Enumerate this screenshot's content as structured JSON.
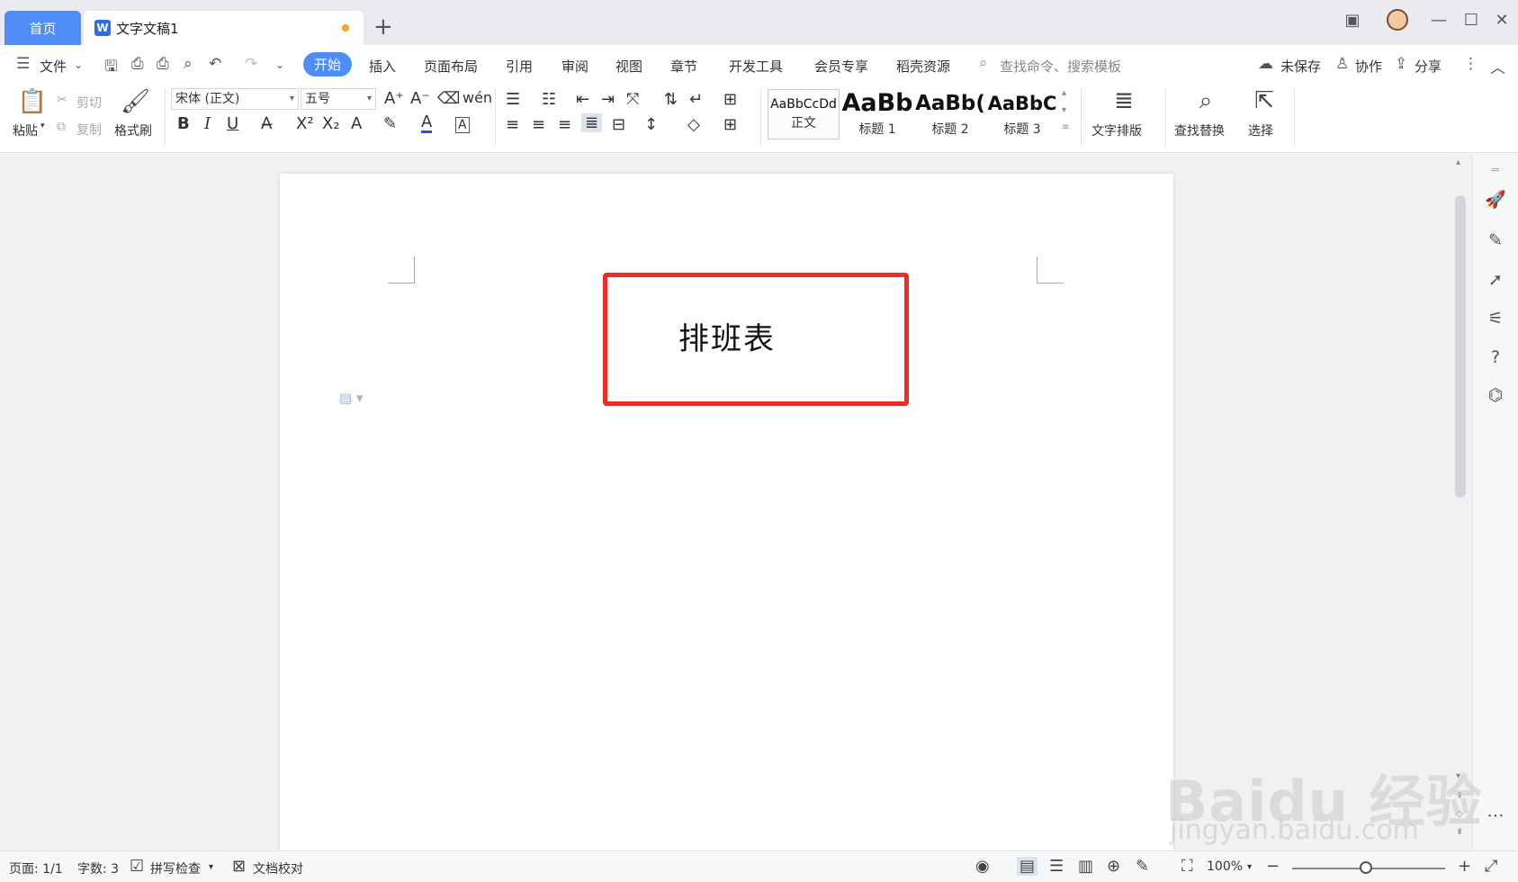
{
  "tabs": {
    "home": "首页",
    "doc": "文字文稿1"
  },
  "menu": {
    "file": "文件",
    "items": [
      "开始",
      "插入",
      "页面布局",
      "引用",
      "审阅",
      "视图",
      "章节",
      "开发工具",
      "会员专享",
      "稻壳资源"
    ],
    "search_placeholder": "查找命令、搜索模板",
    "unsaved": "未保存",
    "collab": "协作",
    "share": "分享"
  },
  "ribbon": {
    "paste": "粘贴",
    "cut": "剪切",
    "copy": "复制",
    "format_painter": "格式刷",
    "font": "宋体 (正文)",
    "size": "五号",
    "styles": [
      {
        "sample": "AaBbCcDd",
        "name": "正文"
      },
      {
        "sample": "AaBb",
        "name": "标题 1"
      },
      {
        "sample": "AaBb(",
        "name": "标题 2"
      },
      {
        "sample": "AaBbC",
        "name": "标题 3"
      }
    ],
    "text_layout": "文字排版",
    "find_replace": "查找替换",
    "select": "选择"
  },
  "document": {
    "title": "排班表"
  },
  "status": {
    "page": "页面: 1/1",
    "words": "字数: 3",
    "spell": "拼写检查",
    "proof": "文档校对",
    "zoom": "100%"
  },
  "watermark": {
    "main": "Baidu 经验",
    "sub": "jingyan.baidu.com"
  },
  "colors": {
    "accent": "#4e8cf6",
    "highlight_border": "#f02a25"
  }
}
